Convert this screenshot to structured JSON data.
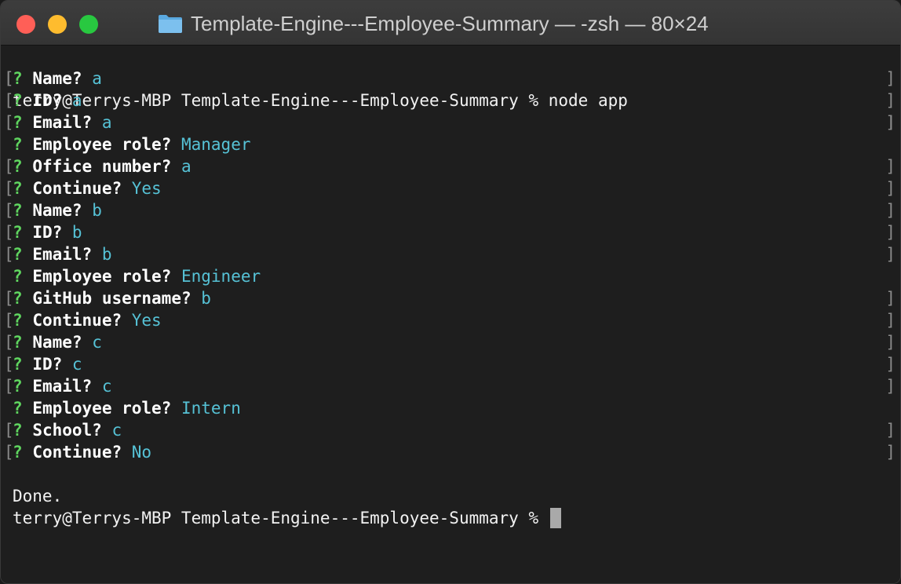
{
  "window": {
    "title": "Template-Engine---Employee-Summary — -zsh — 80×24"
  },
  "terminal": {
    "prompt_line": "terry@Terrys-MBP Template-Engine---Employee-Summary % node app",
    "qa": [
      {
        "mark": "?",
        "label": "Name?",
        "answer": "a",
        "bracketed": true
      },
      {
        "mark": "?",
        "label": "ID?",
        "answer": "a",
        "bracketed": true
      },
      {
        "mark": "?",
        "label": "Email?",
        "answer": "a",
        "bracketed": true
      },
      {
        "mark": "?",
        "label": "Employee role?",
        "answer": "Manager",
        "bracketed": false
      },
      {
        "mark": "?",
        "label": "Office number?",
        "answer": "a",
        "bracketed": true
      },
      {
        "mark": "?",
        "label": "Continue?",
        "answer": "Yes",
        "bracketed": true
      },
      {
        "mark": "?",
        "label": "Name?",
        "answer": "b",
        "bracketed": true
      },
      {
        "mark": "?",
        "label": "ID?",
        "answer": "b",
        "bracketed": true
      },
      {
        "mark": "?",
        "label": "Email?",
        "answer": "b",
        "bracketed": true
      },
      {
        "mark": "?",
        "label": "Employee role?",
        "answer": "Engineer",
        "bracketed": false
      },
      {
        "mark": "?",
        "label": "GitHub username?",
        "answer": "b",
        "bracketed": true
      },
      {
        "mark": "?",
        "label": "Continue?",
        "answer": "Yes",
        "bracketed": true
      },
      {
        "mark": "?",
        "label": "Name?",
        "answer": "c",
        "bracketed": true
      },
      {
        "mark": "?",
        "label": "ID?",
        "answer": "c",
        "bracketed": true
      },
      {
        "mark": "?",
        "label": "Email?",
        "answer": "c",
        "bracketed": true
      },
      {
        "mark": "?",
        "label": "Employee role?",
        "answer": "Intern",
        "bracketed": false
      },
      {
        "mark": "?",
        "label": "School?",
        "answer": "c",
        "bracketed": true
      },
      {
        "mark": "?",
        "label": "Continue?",
        "answer": "No",
        "bracketed": true
      }
    ],
    "done_text": "Done.",
    "final_prompt": "terry@Terrys-MBP Template-Engine---Employee-Summary % "
  },
  "colors": {
    "question_mark": "#5fd45f",
    "answer": "#56c2d6",
    "text": "#f2f2f2",
    "background": "#1e1e1e"
  },
  "icons": {
    "folder": "folder-icon"
  }
}
